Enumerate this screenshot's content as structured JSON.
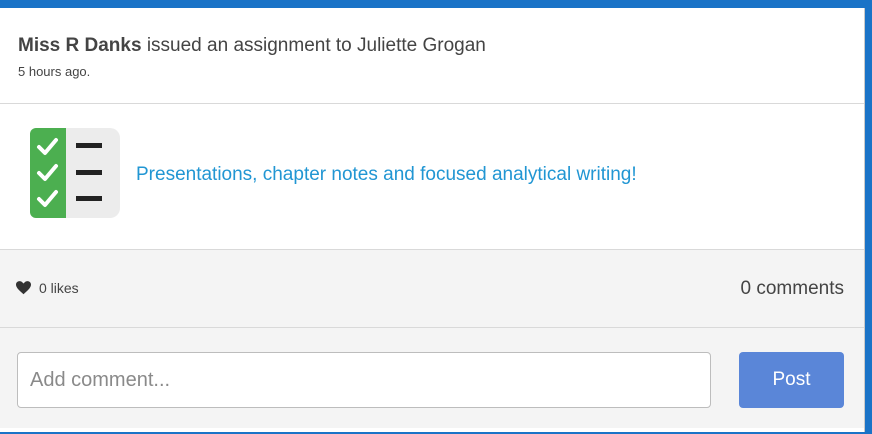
{
  "header": {
    "author": "Miss R Danks",
    "action": " issued an assignment to Juliette Grogan",
    "time": "5 hours ago."
  },
  "assignment": {
    "icon": "checklist-icon",
    "title": "Presentations, chapter notes and focused analytical writing!"
  },
  "stats": {
    "likes_icon": "heart-icon",
    "likes": "0 likes",
    "comments": "0 comments"
  },
  "comment_form": {
    "placeholder": "Add comment...",
    "post_label": "Post"
  },
  "colors": {
    "accent_blue": "#1a73c7",
    "link": "#2196d3",
    "post_button": "#5a86d8",
    "check_green": "#4caf50"
  }
}
